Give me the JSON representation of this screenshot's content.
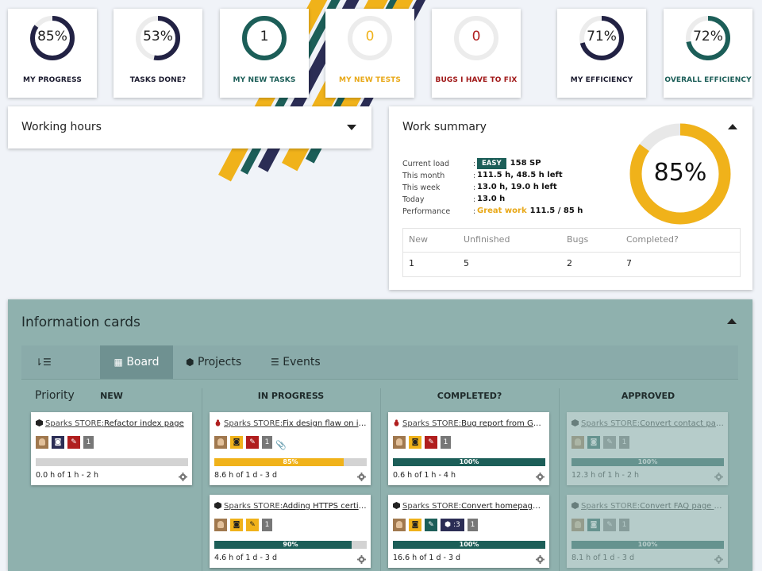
{
  "kpis": [
    {
      "value": "85%",
      "fraction": 0.85,
      "label": "MY PROGRESS",
      "color": "#222244",
      "label_color": "#1a1a2e"
    },
    {
      "value": "53%",
      "fraction": 0.53,
      "label": "TASKS DONE?",
      "color": "#222244",
      "label_color": "#1a1a2e"
    },
    {
      "value": "1",
      "fraction": 1.0,
      "label": "MY NEW TASKS",
      "color": "#1c5e58",
      "label_color": "#1c5e58"
    },
    {
      "value": "0",
      "fraction": 0.0,
      "label": "MY NEW TESTS",
      "color": "#f0b21a",
      "label_color": "#e8a818"
    },
    {
      "value": "0",
      "fraction": 0.0,
      "label": "BUGS I HAVE TO FIX",
      "color": "#b01e1e",
      "label_color": "#a01818"
    },
    {
      "value": "71%",
      "fraction": 0.71,
      "label": "MY EFFICIENCY",
      "color": "#222244",
      "label_color": "#1a1a2e"
    },
    {
      "value": "72%",
      "fraction": 0.72,
      "label": "OVERALL EFFICIENCY",
      "color": "#1c5e58",
      "label_color": "#1c5e58"
    }
  ],
  "working_hours": {
    "title": "Working hours"
  },
  "work_summary": {
    "title": "Work summary",
    "rows": [
      {
        "label": "Current load",
        "sep": ":",
        "badge": "EASY",
        "value": "158 SP"
      },
      {
        "label": "This month",
        "sep": ":",
        "value": "111.5 h, 48.5 h left"
      },
      {
        "label": "This week",
        "sep": ":",
        "value": "13.0 h, 19.0 h left"
      },
      {
        "label": "Today",
        "sep": ":",
        "value": "13.0 h"
      },
      {
        "label": "Performance",
        "sep": ":",
        "highlight": "Great work",
        "value": "111.5 / 85 h"
      }
    ],
    "donut": {
      "value": "85%",
      "fraction": 0.85,
      "color": "#f0b21a"
    },
    "table": {
      "headers": [
        "New",
        "Unfinished",
        "Bugs",
        "Completed?"
      ],
      "values": [
        "1",
        "5",
        "2",
        "7"
      ]
    }
  },
  "info_cards": {
    "title": "Information cards",
    "tabs": [
      {
        "label": "Priority",
        "icon": "sort-icon"
      },
      {
        "label": "Board",
        "icon": "grid-icon"
      },
      {
        "label": "Projects",
        "icon": "cubes-icon"
      },
      {
        "label": "Events",
        "icon": "list-icon"
      }
    ],
    "columns": [
      "NEW",
      "IN PROGRESS",
      "COMPLETED?",
      "APPROVED"
    ],
    "cards": [
      {
        "col": 0,
        "row": 0,
        "type": "task",
        "project": "Sparks STORE:",
        "name": "Refactor index page",
        "badges": [
          "avatar",
          "camera",
          "pen"
        ],
        "count": "1",
        "progress": 0,
        "progress_label": "",
        "bar_color": "#1c5e58",
        "time": "0.0 h of 1 h - 2 h",
        "faded": false
      },
      {
        "col": 1,
        "row": 0,
        "type": "bug",
        "project": "Sparks STORE:",
        "name": "Fix design flaw on ind...",
        "badges": [
          "avatar",
          "camera-y",
          "pen"
        ],
        "count": "1",
        "clip": true,
        "progress": 0.85,
        "progress_label": "85%",
        "bar_color": "#f0b21a",
        "time": "8.6 h of 1 d - 3 d",
        "faded": false
      },
      {
        "col": 1,
        "row": 1,
        "type": "task",
        "project": "Sparks STORE:",
        "name": "Adding HTTPS certifica...",
        "badges": [
          "avatar",
          "camera-y",
          "pen-y"
        ],
        "count": "1",
        "progress": 0.9,
        "progress_label": "90%",
        "bar_color": "#1c5e58",
        "time": "4.6 h of 1 d - 3 d",
        "faded": false
      },
      {
        "col": 2,
        "row": 0,
        "type": "bug",
        "project": "Sparks STORE:",
        "name": "Bug report from Googl...",
        "badges": [
          "avatar",
          "camera-y",
          "pen"
        ],
        "count": "1",
        "progress": 1.0,
        "progress_label": "100%",
        "bar_color": "#1c5e58",
        "time": "0.6 h of 1 h - 4 h",
        "faded": false
      },
      {
        "col": 2,
        "row": 1,
        "type": "task",
        "project": "Sparks STORE:",
        "name": "Convert homepage d...",
        "badges": [
          "avatar",
          "camera-y",
          "pen-g"
        ],
        "count": "1",
        "sub": "3",
        "progress": 1.0,
        "progress_label": "100%",
        "bar_color": "#1c5e58",
        "time": "16.6 h of 1 d - 3 d",
        "faded": false
      },
      {
        "col": 3,
        "row": 0,
        "type": "task",
        "project": "Sparks STORE:",
        "name": "Convert contact page...",
        "badges": [
          "avatar",
          "camera-g",
          "pen-gray"
        ],
        "count": "1",
        "progress": 1.0,
        "progress_label": "100%",
        "bar_color": "#1c5e58",
        "time": "12.3 h of 1 h - 2 h",
        "faded": true
      },
      {
        "col": 3,
        "row": 1,
        "type": "task",
        "project": "Sparks STORE:",
        "name": "Convert FAQ page de...",
        "badges": [
          "avatar",
          "camera-g",
          "pen-gray"
        ],
        "count": "1",
        "progress": 1.0,
        "progress_label": "100%",
        "bar_color": "#1c5e58",
        "time": "8.1 h of 1 d - 3 d",
        "faded": true
      }
    ]
  }
}
